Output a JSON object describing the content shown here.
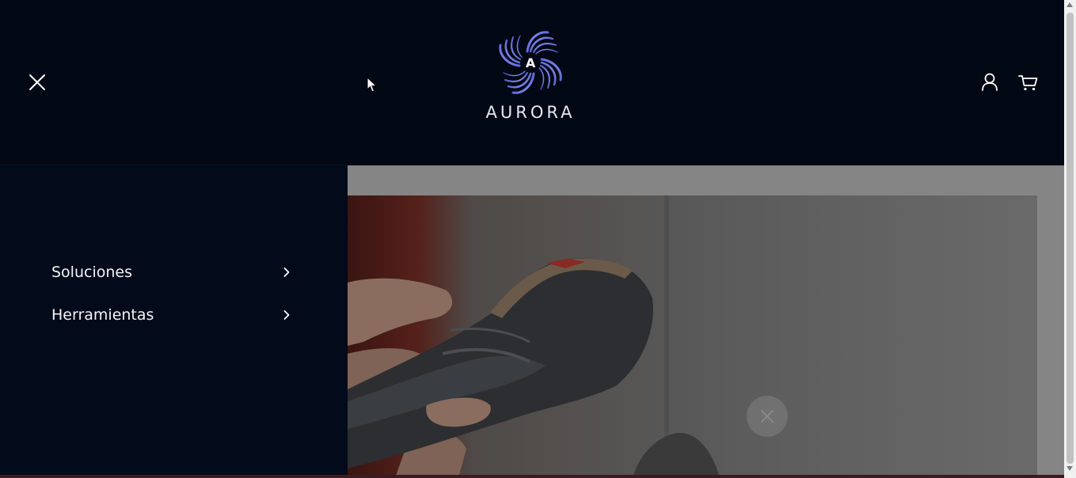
{
  "header": {
    "brand": {
      "name": "AURORA",
      "emblem_letter": "A"
    },
    "icons": {
      "close": "close-icon",
      "account": "user-icon",
      "cart": "cart-icon"
    }
  },
  "menu": {
    "items": [
      {
        "label": "Soluciones",
        "icon": "chevron-right-icon"
      },
      {
        "label": "Herramientas",
        "icon": "chevron-right-icon"
      }
    ]
  },
  "hero": {
    "image": "card-payment-terminal-photo",
    "close_icon": "close-icon"
  },
  "colors": {
    "background": "#020814",
    "drawer": "#030a19",
    "text": "#f4f5f8",
    "brand_blue": "#4a56c8",
    "overlay_gray": "#858585"
  }
}
